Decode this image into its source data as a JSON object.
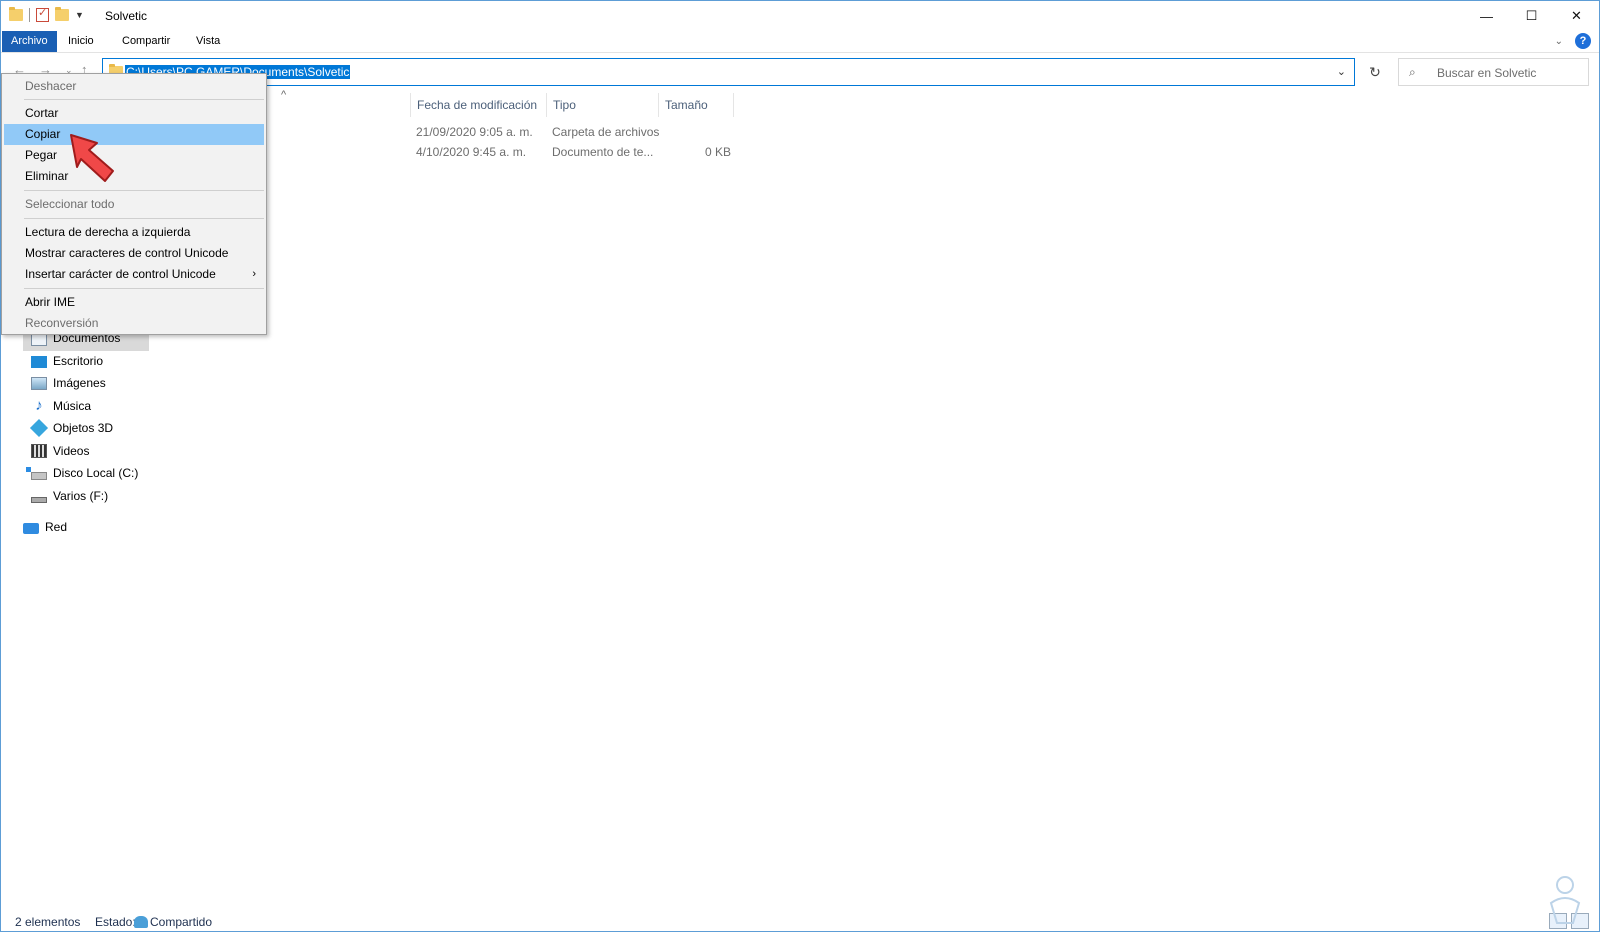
{
  "window": {
    "title": "Solvetic"
  },
  "ribbon": {
    "tabs": [
      "Archivo",
      "Inicio",
      "Compartir",
      "Vista"
    ],
    "help": "?"
  },
  "address_bar": {
    "path": "C:\\Users\\PC GAMER\\Documents\\Solvetic"
  },
  "search": {
    "placeholder": "Buscar en Solvetic"
  },
  "columns": {
    "date": "Fecha de modificación",
    "type": "Tipo",
    "size": "Tamaño"
  },
  "files": [
    {
      "date": "21/09/2020 9:05 a. m.",
      "type": "Carpeta de archivos",
      "size": ""
    },
    {
      "date": "4/10/2020 9:45 a. m.",
      "type": "Documento de te...",
      "size": "0 KB"
    }
  ],
  "nav_pane": {
    "items": [
      {
        "label": "Documentos",
        "icon": "documents-icon",
        "selected": true
      },
      {
        "label": "Escritorio",
        "icon": "desktop-icon"
      },
      {
        "label": "Imágenes",
        "icon": "pictures-icon"
      },
      {
        "label": "Música",
        "icon": "music-icon"
      },
      {
        "label": "Objetos 3D",
        "icon": "3d-objects-icon"
      },
      {
        "label": "Videos",
        "icon": "videos-icon"
      },
      {
        "label": "Disco Local (C:)",
        "icon": "local-disk-icon"
      },
      {
        "label": "Varios (F:)",
        "icon": "drive-icon"
      }
    ],
    "network": "Red"
  },
  "context_menu": {
    "items": [
      {
        "label": "Deshacer",
        "enabled": false
      },
      {
        "label": "Cortar",
        "enabled": true
      },
      {
        "label": "Copiar",
        "enabled": true,
        "highlighted": true
      },
      {
        "label": "Pegar",
        "enabled": true
      },
      {
        "label": "Eliminar",
        "enabled": true
      },
      {
        "label": "Seleccionar todo",
        "enabled": false
      },
      {
        "label": "Lectura de derecha a izquierda",
        "enabled": true
      },
      {
        "label": "Mostrar caracteres de control Unicode",
        "enabled": true
      },
      {
        "label": "Insertar carácter de control Unicode",
        "enabled": true,
        "submenu": true
      },
      {
        "label": "Abrir IME",
        "enabled": true
      },
      {
        "label": "Reconversión",
        "enabled": false
      }
    ]
  },
  "status_bar": {
    "count": "2 elementos",
    "state_label": "Estado:",
    "state_value": "Compartido"
  },
  "colors": {
    "accent": "#0078d7",
    "file_tab": "#1a5fb4",
    "menu_highlight": "#91c9f7",
    "pointer": "#f04848"
  }
}
